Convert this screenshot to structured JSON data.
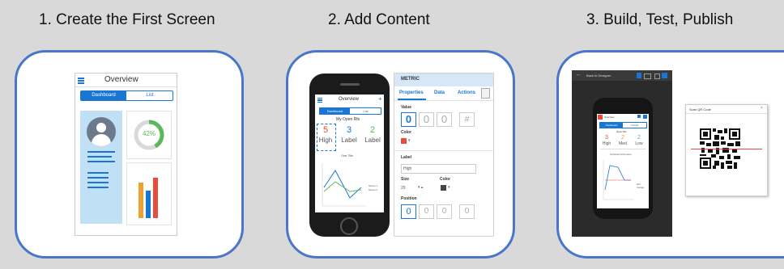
{
  "steps": [
    {
      "title": "1.  Create the First Screen"
    },
    {
      "title": "2.  Add Content"
    },
    {
      "title": "3.  Build, Test, Publish"
    }
  ],
  "screen1": {
    "header_title": "Overview",
    "tabs": [
      "Dashboard",
      "List"
    ],
    "gauge_value": "42%",
    "colors": {
      "accent": "#1976d2",
      "panel_bg": "#bfe0f5",
      "gauge": "#5cb85c"
    }
  },
  "screen2": {
    "phone": {
      "header_title": "Overview",
      "tabs": [
        "Dashboard",
        "List"
      ],
      "section_title": "My Open Rfs",
      "metrics": [
        {
          "value": "5",
          "label": "High",
          "color": "#e74c3c"
        },
        {
          "value": "3",
          "label": "Label",
          "color": "#1976d2"
        },
        {
          "value": "2",
          "label": "Label",
          "color": "#5cb85c"
        }
      ],
      "chart_title": "Over Title",
      "series": [
        "Series 1",
        "Series 2"
      ]
    },
    "props": {
      "title": "METRIC",
      "tabs": [
        "Properties",
        "Data",
        "Actions"
      ],
      "value_label": "Value",
      "value_options": [
        "0",
        "0",
        "0",
        "#"
      ],
      "color_label": "Color",
      "label_label": "Label",
      "label_value": "High",
      "size_label": "Size",
      "size_value": "20",
      "color2_label": "Color",
      "position_label": "Position",
      "position_options": [
        "0",
        "0",
        "0",
        "0"
      ]
    }
  },
  "screen3": {
    "toolbar_title": "Back to Designer",
    "phone": {
      "header_title": "Overview",
      "tabs": [
        "Dashboard",
        "Details"
      ],
      "section_title": "Open Rfs",
      "metrics": [
        {
          "value": "3",
          "label": "High",
          "color": "#e74c3c"
        },
        {
          "value": "2",
          "label": "Med",
          "color": "#f0a030"
        },
        {
          "value": "2",
          "label": "Low",
          "color": "#5cb85c"
        }
      ],
      "chart_title": "Technician Performance",
      "legend": [
        "Won",
        "Average"
      ]
    },
    "qr_title": "Scan QR Code"
  }
}
